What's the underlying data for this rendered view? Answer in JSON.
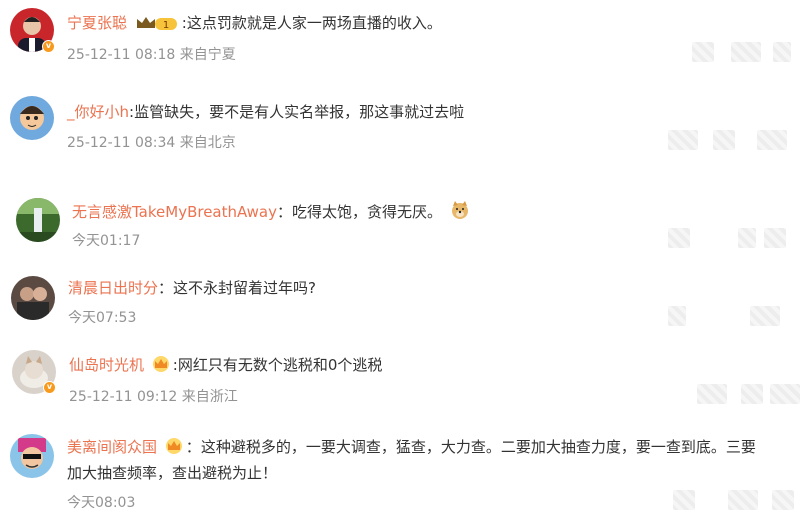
{
  "comments": [
    {
      "username": "宁夏张聪",
      "separator": ":",
      "text": "这点罚款就是人家一两场直播的收入。",
      "meta": "25-12-11 08:18 来自宁夏",
      "badge_level": "1"
    },
    {
      "username": "_你好小h",
      "separator": ":",
      "text": "监管缺失，要不是有人实名举报，那这事就过去啦",
      "meta": "25-12-11 08:34 来自北京"
    },
    {
      "username": "无言感激TakeMyBreathAway",
      "separator": "：",
      "text": "吃得太饱，贪得无厌。",
      "meta": "今天01:17"
    },
    {
      "username": "清晨日出时分",
      "separator": "：",
      "text": "这不永封留着过年吗?",
      "meta": "今天07:53"
    },
    {
      "username": "仙岛时光机",
      "separator": ":",
      "text": "网红只有无数个逃税和0个逃税",
      "meta": "25-12-11 09:12 来自浙江"
    },
    {
      "username": "美离间阂众国",
      "separator": "：",
      "text": "这种避税多的，一要大调查，猛查，大力查。二要加大抽查力度，要一查到底。三要",
      "text_line2": "加大抽查频率，查出避税为止！",
      "meta": "今天08:03"
    }
  ],
  "colors": {
    "username": "#eb7350",
    "meta": "#939393",
    "text": "#333333"
  }
}
